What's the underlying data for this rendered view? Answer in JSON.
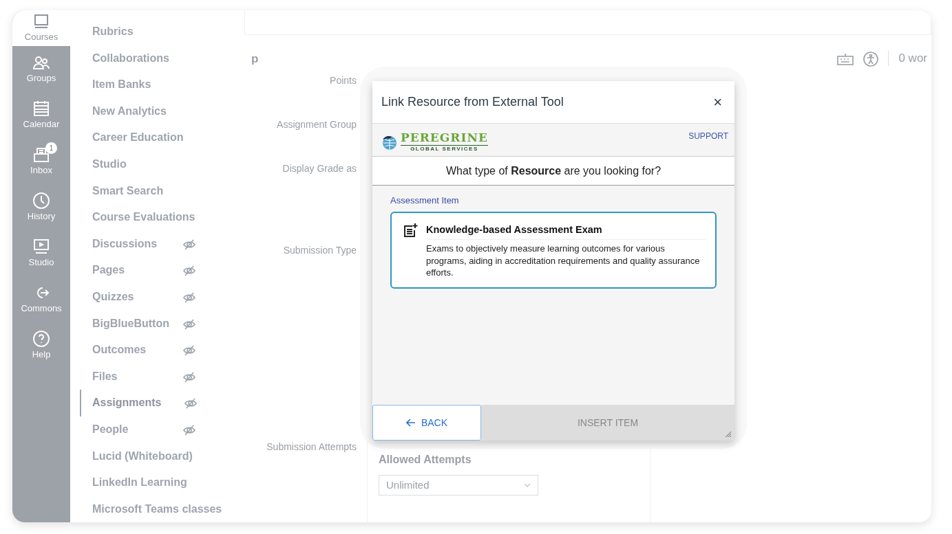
{
  "global_nav": [
    {
      "label": "Courses",
      "selected": true
    },
    {
      "label": "Groups",
      "selected": false
    },
    {
      "label": "Calendar",
      "selected": false
    },
    {
      "label": "Inbox",
      "selected": false,
      "badge": "1"
    },
    {
      "label": "History",
      "selected": false
    },
    {
      "label": "Studio",
      "selected": false
    },
    {
      "label": "Commons",
      "selected": false
    },
    {
      "label": "Help",
      "selected": false
    }
  ],
  "course_nav": [
    {
      "label": "Rubrics",
      "hidden": false,
      "selected": false
    },
    {
      "label": "Collaborations",
      "hidden": false,
      "selected": false
    },
    {
      "label": "Item Banks",
      "hidden": false,
      "selected": false
    },
    {
      "label": "New Analytics",
      "hidden": false,
      "selected": false
    },
    {
      "label": "Career Education",
      "hidden": false,
      "selected": false
    },
    {
      "label": "Studio",
      "hidden": false,
      "selected": false
    },
    {
      "label": "Smart Search",
      "hidden": false,
      "selected": false
    },
    {
      "label": "Course Evaluations",
      "hidden": false,
      "selected": false
    },
    {
      "label": "Discussions",
      "hidden": true,
      "selected": false
    },
    {
      "label": "Pages",
      "hidden": true,
      "selected": false
    },
    {
      "label": "Quizzes",
      "hidden": true,
      "selected": false
    },
    {
      "label": "BigBlueButton",
      "hidden": true,
      "selected": false
    },
    {
      "label": "Outcomes",
      "hidden": true,
      "selected": false
    },
    {
      "label": "Files",
      "hidden": true,
      "selected": false
    },
    {
      "label": "Assignments",
      "hidden": true,
      "selected": true
    },
    {
      "label": "People",
      "hidden": true,
      "selected": false
    },
    {
      "label": "Lucid (Whiteboard)",
      "hidden": false,
      "selected": false
    },
    {
      "label": "LinkedIn Learning",
      "hidden": false,
      "selected": false
    },
    {
      "label": "Microsoft Teams classes",
      "hidden": false,
      "selected": false
    }
  ],
  "editor": {
    "title": "p",
    "word_count": "0 wor"
  },
  "form": {
    "labels": [
      "Points",
      "Assignment Group",
      "Display Grade as",
      "Submission Type",
      "Submission Attempts"
    ],
    "attempts_label": "Allowed Attempts",
    "attempts_value": "Unlimited"
  },
  "modal": {
    "title": "Link Resource from External Tool",
    "close": "×",
    "brand": {
      "name": "PEREGRINE",
      "tagline": "GLOBAL SERVICES"
    },
    "support": "SUPPORT",
    "question": "What type of **Resource** are you looking for?",
    "section": "Assessment Item",
    "items": [
      {
        "title": "Knowledge-based Assessment Exam",
        "description": "Exams to objectively measure learning outcomes for various programs, aiding in accreditation requirements and quality assurance efforts.",
        "selected": true
      }
    ],
    "back": "BACK",
    "insert": "INSERT ITEM",
    "insert_disabled": true
  }
}
